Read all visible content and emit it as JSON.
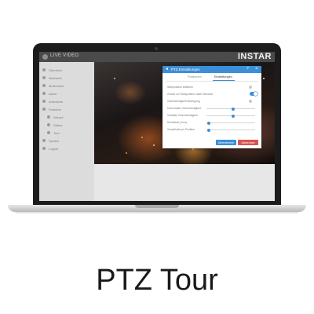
{
  "app": {
    "title": "LIVE VIDEO",
    "brand": "INSTAR"
  },
  "sidebar": {
    "items": [
      {
        "label": "Übersicht"
      },
      {
        "label": "Netzwerk"
      },
      {
        "label": "Multimedia"
      },
      {
        "label": "Alarm"
      },
      {
        "label": "Aufnahme"
      },
      {
        "label": "Features"
      },
      {
        "label": "Wizard"
      },
      {
        "label": "Status"
      },
      {
        "label": "Tour"
      },
      {
        "label": "System"
      },
      {
        "label": "Logout"
      }
    ]
  },
  "dialog": {
    "title": "PTZ Einstellungen",
    "tabs": [
      {
        "label": "Positionen",
        "active": false
      },
      {
        "label": "Einstellungen",
        "active": true
      }
    ],
    "settings": [
      {
        "label": "Startposition anfahren",
        "control": "icon"
      },
      {
        "label": "Zurück zur Startposition nach Neustart",
        "control": "toggle",
        "value": "on"
      },
      {
        "label": "Geschwindigkeit Bewegung",
        "control": "icon"
      },
      {
        "label": "Horizontale Geschwindigkeit",
        "control": "slider",
        "value": 0.55
      },
      {
        "label": "Vertikale Geschwindigkeit",
        "control": "slider",
        "value": 0.55
      },
      {
        "label": "Rundläufe (Tour)",
        "control": "slider",
        "value": 0.05
      },
      {
        "label": "Verweilzeit pro Position",
        "control": "slider",
        "value": 0.05
      }
    ],
    "buttons": {
      "submit": "Übernehmen",
      "cancel": "Abbrechen"
    }
  },
  "caption": "PTZ Tour",
  "colors": {
    "accent": "#3b8fd6",
    "danger": "#d9534f",
    "topbar": "#4a4a4a",
    "sidebar": "#dcdcdc"
  }
}
